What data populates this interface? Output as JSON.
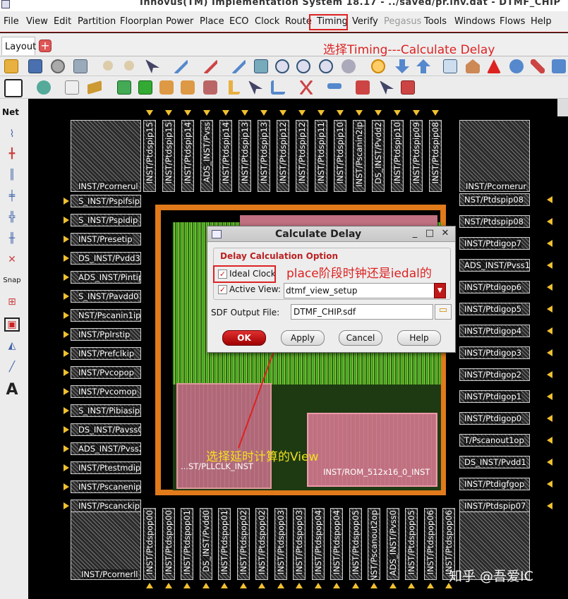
{
  "window": {
    "title": "Innovus(TM) Implementation System 18.17 - ../saved/pr.inv.dat - DTMF_CHIP"
  },
  "menubar": {
    "items": [
      "File",
      "View",
      "Edit",
      "Partition",
      "Floorplan",
      "Power",
      "Place",
      "ECO",
      "Clock",
      "Route",
      "Timing",
      "Verify",
      "Pegasus",
      "Tools",
      "Windows",
      "Flows",
      "Help"
    ]
  },
  "tab": {
    "label": "Layout",
    "add_symbol": "+"
  },
  "annotations": {
    "step": "选择Timing---Calculate Delay",
    "ideal_note": "place阶段时钟还是iedal的",
    "view_note": "选择延时计算的View"
  },
  "left_palette": {
    "net_label": "Net",
    "snap_label": "Snap",
    "text_tool": "A"
  },
  "pads": {
    "corner_tl": "INST/Pcornerul",
    "corner_tr": "INST/Pcornerur",
    "corner_bl": "INST/Pcornerll",
    "corner_br": "",
    "left": [
      "S_INST/Pspifsip",
      "S_INST/Pspidip",
      "INST/Presetip",
      "DS_INST/Pvdd3",
      "ADS_INST/Pintip",
      "S_INST/Pavdd0",
      "NST/Pscanin1ip",
      "INST/Pplrstip",
      "INST/Prefclkip",
      "INST/Pvcopop",
      "INST/Pvcomop",
      "S_INST/Pibiasip",
      "DS_INST/Pavss0",
      "ADS_INST/Pvss2",
      "INST/Ptestmdip",
      "INST/Pscanenip",
      "INST/Pscanckip"
    ],
    "right": [
      "NST/Ptdspip08",
      "NST/Ptdspip08",
      "INST/Ptdigop7",
      "ADS_INST/Pvss1",
      "INST/Ptdigop6",
      "INST/Ptdigop5",
      "INST/Ptdigop4",
      "INST/Ptdigop3",
      "INST/Ptdigop2",
      "INST/Ptdigop1",
      "INST/Ptdigop0",
      "T/Pscanout1op",
      "DS_INST/Pvdd1",
      "INST/Ptdigfgop",
      "INST/Ptdspip07"
    ],
    "top": [
      "INST/Ptdspip15",
      "INST/Ptdspip15",
      "INST/Ptdspip14",
      "ADS_INST/Pvss",
      "INST/Ptdspip14",
      "INST/Ptdspip13",
      "INST/Ptdspip13",
      "INST/Ptdspip12",
      "INST/Ptdspip12",
      "INST/Ptdspip11",
      "INST/Ptdspip10",
      "INST/Pscanin2ip",
      "DS_INST/Pvdd2",
      "INST/Ptdspip10",
      "INST/Ptdspip09",
      "INST/Ptdspip08"
    ],
    "bottom": [
      "INST/Ptdspop00",
      "INST/Ptdspop00",
      "INST/Ptdspop01",
      "DS_INST/Pvdd0",
      "INST/Ptdspop01",
      "INST/Ptdspop02",
      "INST/Ptdspop02",
      "INST/Ptdspop03",
      "INST/Ptdspop03",
      "INST/Ptdspop04",
      "INST/Ptdspop04",
      "INST/Ptdspop05",
      "INST/Pscanout2op",
      "ADS_INST/Pvss0",
      "INST/Ptdspop05",
      "INST/Ptdspop06",
      "INST/Ptdspop06"
    ]
  },
  "core": {
    "pll_label": "...ST/PLLCLK_INST",
    "rom_label": "INST/ROM_512x16_0_INST"
  },
  "watermark": "知乎 @吾爱IC",
  "dialog": {
    "title": "Calculate Delay",
    "controls": {
      "minimize": "_",
      "maximize": "□",
      "close": "✕"
    },
    "group_title": "Delay Calculation Option",
    "ideal_clock": {
      "label": "Ideal Clock",
      "checked": true
    },
    "active_view": {
      "label": "Active View:",
      "checked": true,
      "value": "dtmf_view_setup"
    },
    "sdf": {
      "label": "SDF Output File:",
      "value": "DTMF_CHIP.sdf"
    },
    "buttons": {
      "ok": "OK",
      "apply": "Apply",
      "cancel": "Cancel",
      "help": "Help"
    }
  },
  "colors": {
    "ring": "#e07a1a",
    "pad_arrow": "#f0c030",
    "annotation_red": "#d22",
    "annotation_yellow": "#f2e020"
  }
}
